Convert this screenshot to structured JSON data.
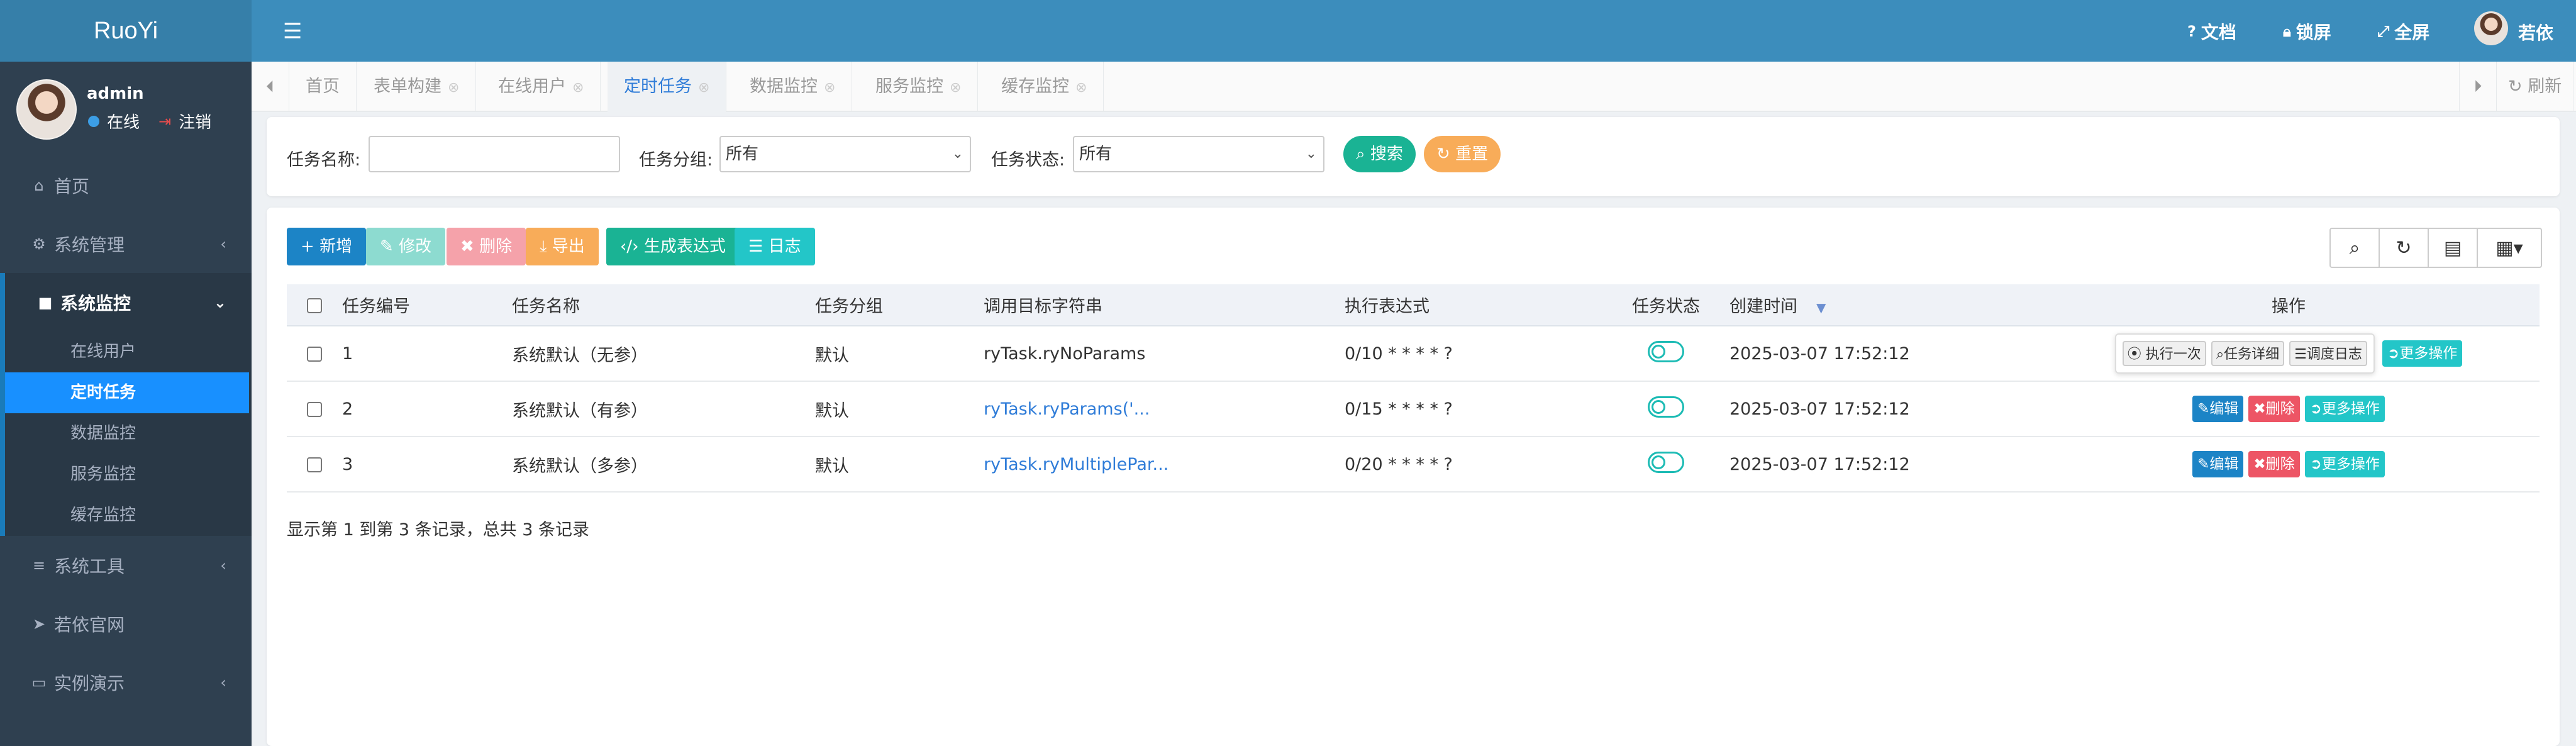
{
  "brand": "RuoYi",
  "user": {
    "name": "admin",
    "status": "在线",
    "logout": "注销"
  },
  "menu": {
    "home": "首页",
    "system": "系统管理",
    "monitor": "系统监控",
    "monitor_sub": [
      "在线用户",
      "定时任务",
      "数据监控",
      "服务监控",
      "缓存监控"
    ],
    "tools": "系统工具",
    "site": "若依官网",
    "demo": "实例演示"
  },
  "header": {
    "docs": "文档",
    "lock": "锁屏",
    "fullscreen": "全屏",
    "username": "若依"
  },
  "tabs": [
    "首页",
    "表单构建",
    "在线用户",
    "定时任务",
    "数据监控",
    "服务监控",
    "缓存监控"
  ],
  "refresh": "刷新",
  "search": {
    "name_label": "任务名称:",
    "name_value": "",
    "group_label": "任务分组:",
    "group_value": "所有",
    "status_label": "任务状态:",
    "status_value": "所有",
    "search_btn": "搜索",
    "reset_btn": "重置"
  },
  "toolbar": {
    "add": "新增",
    "edit": "修改",
    "delete": "删除",
    "export": "导出",
    "cron": "生成表达式",
    "log": "日志"
  },
  "table": {
    "columns": [
      "任务编号",
      "任务名称",
      "任务分组",
      "调用目标字符串",
      "执行表达式",
      "任务状态",
      "创建时间",
      "操作"
    ],
    "rows": [
      {
        "id": "1",
        "name": "系统默认（无参）",
        "group": "默认",
        "target": "ryTask.ryNoParams",
        "cron": "0/10 * * * * ?",
        "created": "2025-03-07 17:52:12"
      },
      {
        "id": "2",
        "name": "系统默认（有参）",
        "group": "默认",
        "target": "ryTask.ryParams('...",
        "cron": "0/15 * * * * ?",
        "created": "2025-03-07 17:52:12"
      },
      {
        "id": "3",
        "name": "系统默认（多参）",
        "group": "默认",
        "target": "ryTask.ryMultiplePar...",
        "cron": "0/20 * * * * ?",
        "created": "2025-03-07 17:52:12"
      }
    ],
    "ops": {
      "run_once": "执行一次",
      "detail": "任务详细",
      "log": "调度日志",
      "more": "更多操作",
      "edit": "编辑",
      "delete": "删除"
    }
  },
  "pager": "显示第 1 到第 3 条记录，总共 3 条记录",
  "colors": {
    "sidebar": "#2f4050",
    "header": "#3c8dbc",
    "active": "#1890ff",
    "primary": "#1c84c6",
    "teal": "#1ab394",
    "orange": "#f8ac59",
    "danger": "#ed5565",
    "info": "#23c6c8"
  }
}
